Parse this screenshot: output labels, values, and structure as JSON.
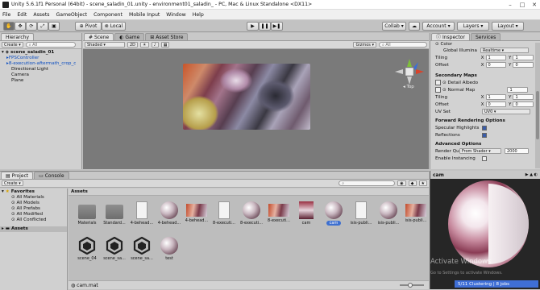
{
  "window": {
    "title": "Unity 5.6.1f1 Personal (64bit) - scene_saladin_01.unity - environment01_saladin_ - PC, Mac & Linux Standalone <DX11>"
  },
  "menu": [
    "File",
    "Edit",
    "Assets",
    "GameObject",
    "Component",
    "Mobile Input",
    "Window",
    "Help"
  ],
  "toolbar": {
    "pivot": "Pivot",
    "local": "Local",
    "collab": "Collab",
    "account": "Account",
    "layers": "Layers",
    "layout": "Layout"
  },
  "hierarchy": {
    "tab": "Hierarchy",
    "create": "Create",
    "search_placeholder": "All",
    "scene": "scene_saladin_01",
    "items": [
      "FPSController",
      "8-execution-aftermath_crop_c",
      "Directional Light",
      "Camera",
      "Plane"
    ]
  },
  "scene_view": {
    "tabs": [
      "Scene",
      "Game",
      "Asset Store"
    ],
    "shading": "Shaded",
    "mode": "2D",
    "gizmos": "Gizmos",
    "search_placeholder": "All",
    "gizmo_label": "Top"
  },
  "inspector": {
    "tabs": [
      "Inspector",
      "Services"
    ],
    "color_label": "Color",
    "illum_label": "Global Illumina",
    "illum_value": "Realtime",
    "tiling_label": "Tiling",
    "offset_label": "Offset",
    "tiling1": {
      "x": "1",
      "y": "1"
    },
    "offset1": {
      "x": "0",
      "y": "0"
    },
    "secondary_maps": "Secondary Maps",
    "detail_albedo": "Detail Albedo",
    "normal_map": "Normal Map",
    "normal_value": "1",
    "tiling2": {
      "x": "1",
      "y": "1"
    },
    "offset2": {
      "x": "0",
      "y": "0"
    },
    "uv_set_label": "UV Set",
    "uv_set_value": "UV0",
    "forward_options": "Forward Rendering Options",
    "specular": "Specular Highlights",
    "reflections": "Reflections",
    "advanced": "Advanced Options",
    "render_queue": "Render Queu",
    "render_queue_mode": "From Shader",
    "render_queue_value": "2000",
    "instancing": "Enable Instancing"
  },
  "project": {
    "tabs": [
      "Project",
      "Console"
    ],
    "create": "Create",
    "favorites": "Favorites",
    "fav_items": [
      "All Materials",
      "All Models",
      "All Prefabs",
      "All Modified",
      "All Conflicted"
    ],
    "assets_root": "Assets",
    "breadcrumb": "Assets",
    "assets": [
      {
        "label": "Materials",
        "kind": "folder"
      },
      {
        "label": "Standard...",
        "kind": "folder"
      },
      {
        "label": "4-behead...",
        "kind": "file"
      },
      {
        "label": "4-behead...",
        "kind": "sphere"
      },
      {
        "label": "4-behead...",
        "kind": "image"
      },
      {
        "label": "8-executi...",
        "kind": "file"
      },
      {
        "label": "8-executi...",
        "kind": "sphere"
      },
      {
        "label": "8-executi...",
        "kind": "image"
      },
      {
        "label": "cam",
        "kind": "tall"
      },
      {
        "label": "cam",
        "kind": "sphere",
        "selected": true
      },
      {
        "label": "isis-publi...",
        "kind": "file"
      },
      {
        "label": "isis-publi...",
        "kind": "sphere"
      },
      {
        "label": "isis-publi...",
        "kind": "image"
      },
      {
        "label": "scene_04",
        "kind": "unity"
      },
      {
        "label": "scene_sa...",
        "kind": "unity"
      },
      {
        "label": "scene_sa...",
        "kind": "unity"
      },
      {
        "label": "test",
        "kind": "sphere"
      }
    ],
    "footer_file": "cam.mat"
  },
  "preview": {
    "title": "cam",
    "watermark": "Activate Windows",
    "watermark_sub": "Go to Settings to activate Windows.",
    "status": "5/11 Clustering | 8 jobs"
  }
}
